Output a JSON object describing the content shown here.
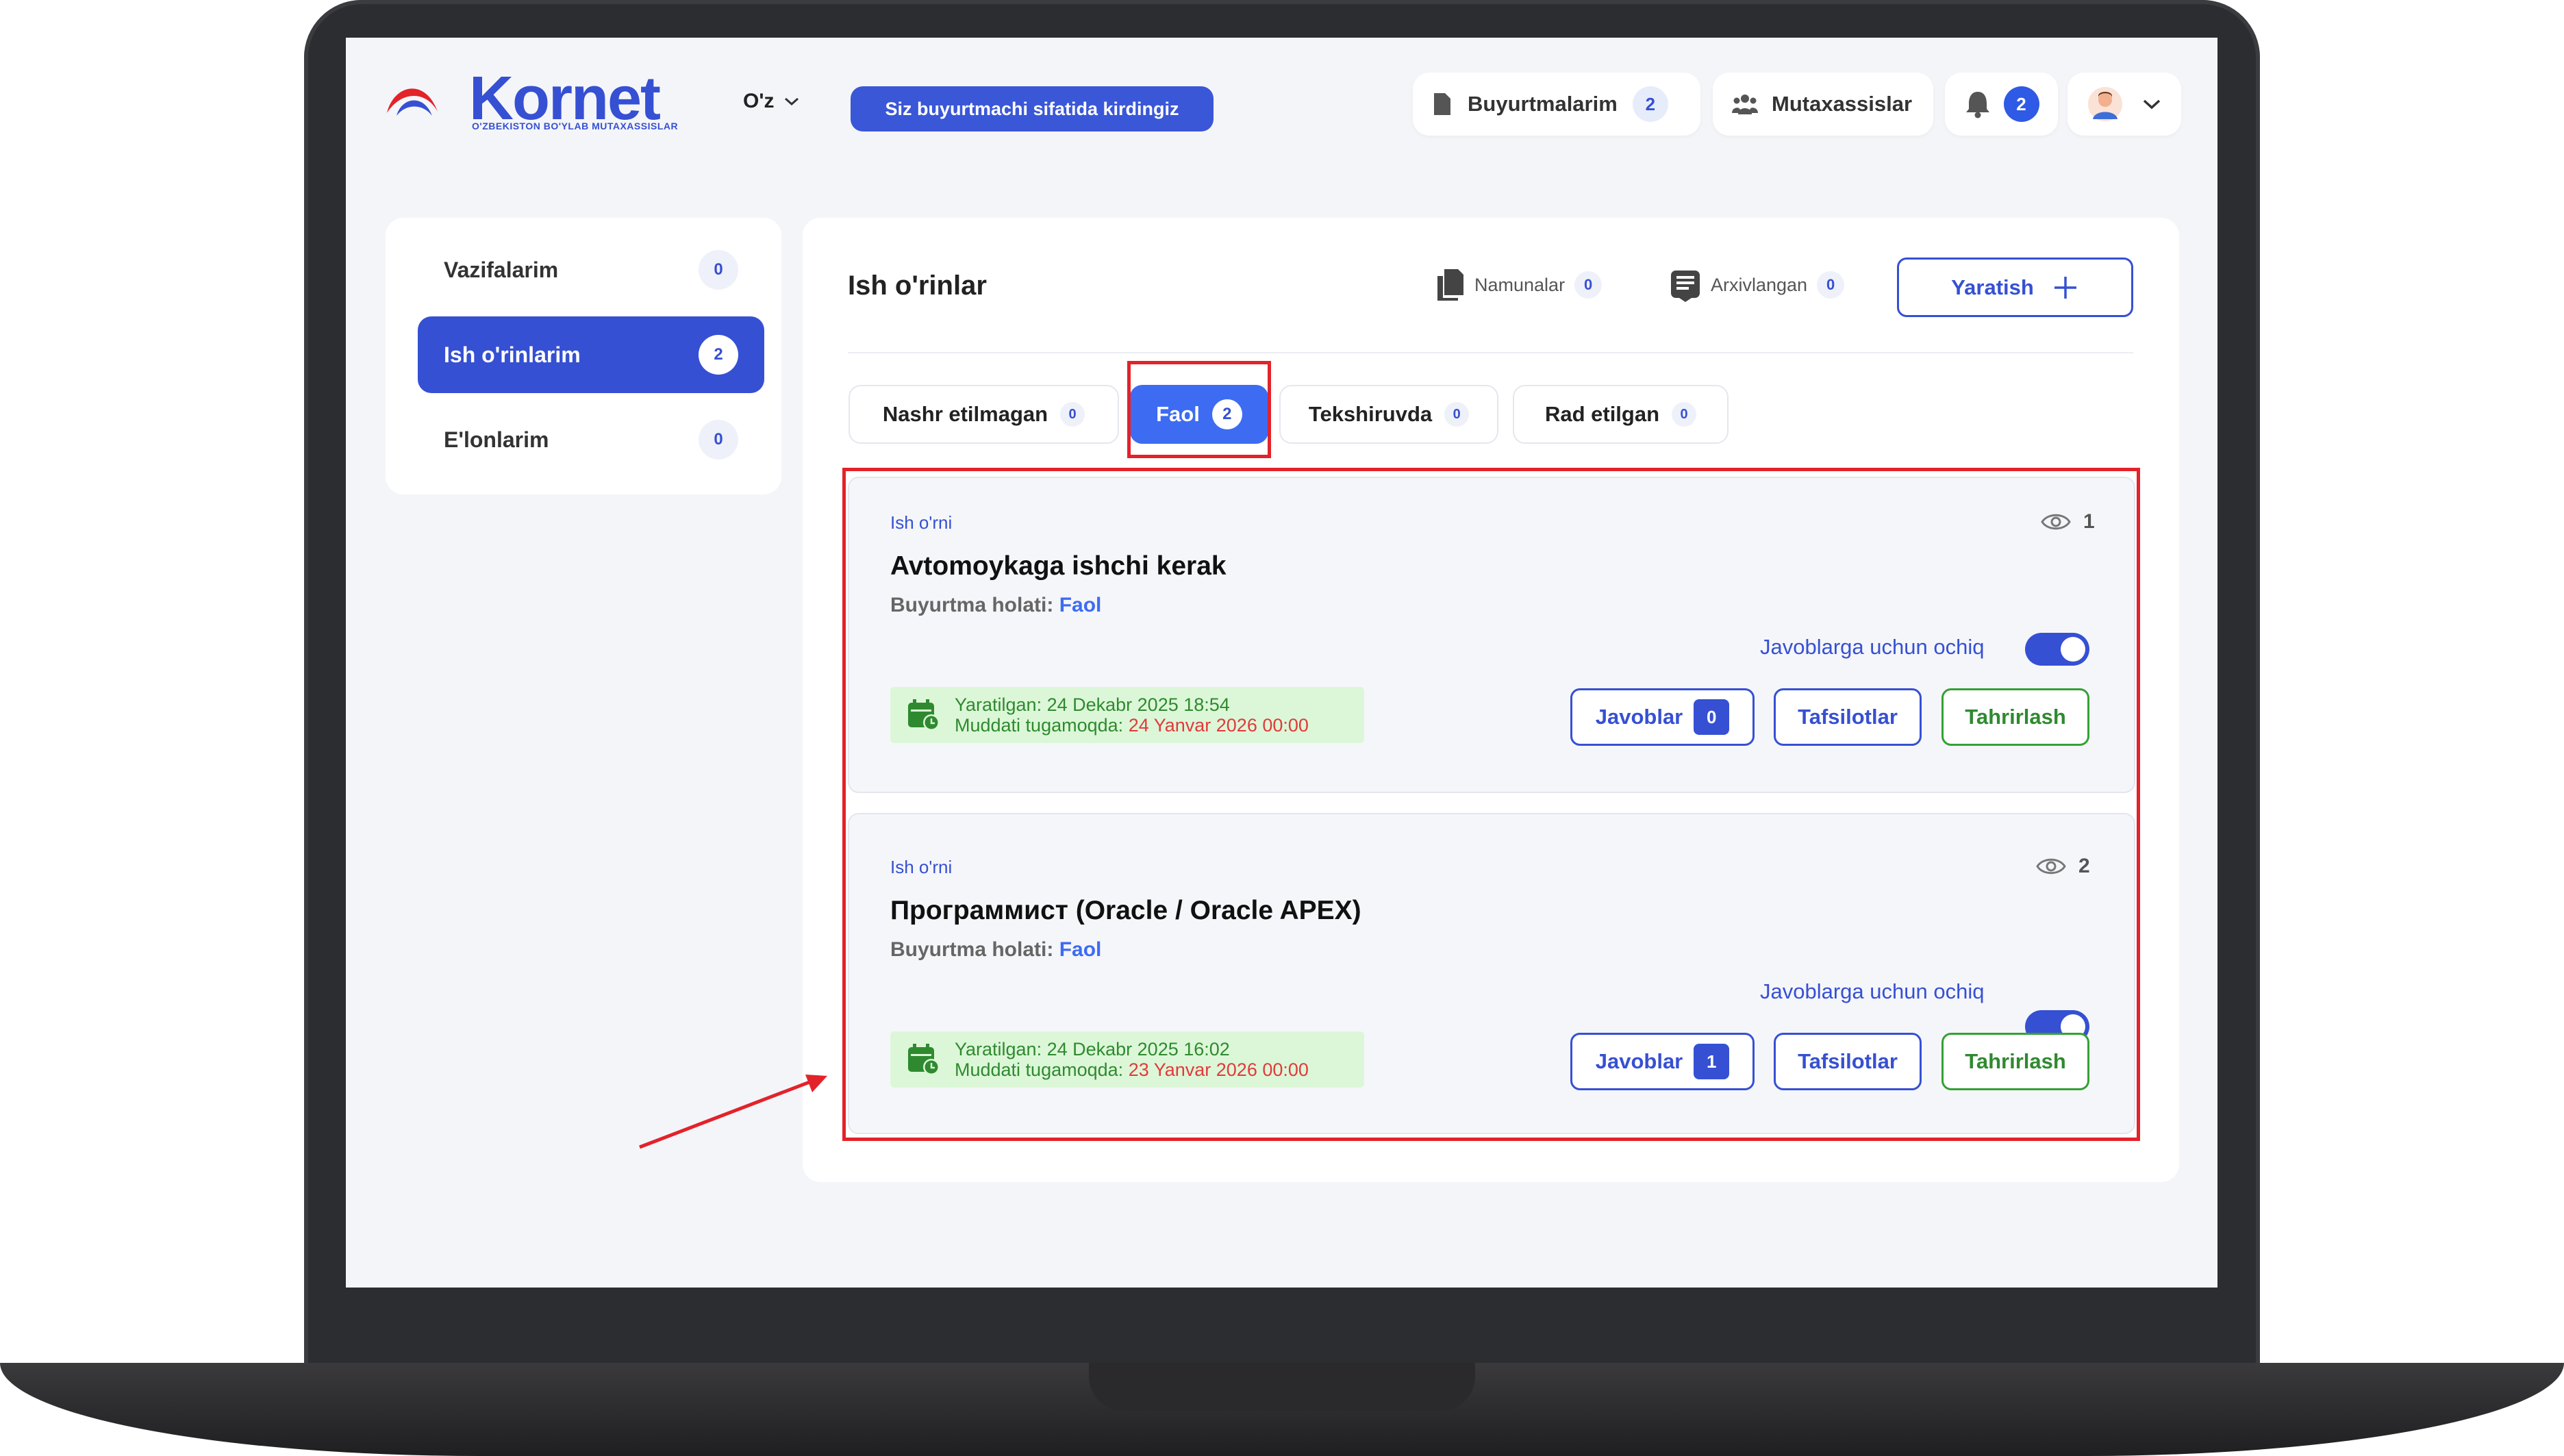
{
  "header": {
    "logo": "Kornet",
    "logo_subtitle": "O'ZBEKISTON BO'YLAB MUTAXASSISLAR",
    "language": "O'z",
    "role_badge": "Siz buyurtmachi sifatida kirdingiz",
    "orders_label": "Buyurtmalarim",
    "orders_count": "2",
    "specialists_label": "Mutaxassislar",
    "notifications_count": "2"
  },
  "sidebar": {
    "items": [
      {
        "label": "Vazifalarim",
        "count": "0"
      },
      {
        "label": "Ish o'rinlarim",
        "count": "2"
      },
      {
        "label": "E'lonlarim",
        "count": "0"
      }
    ]
  },
  "main": {
    "title": "Ish o'rinlar",
    "samples_label": "Namunalar",
    "samples_count": "0",
    "archived_label": "Arxivlangan",
    "archived_count": "0",
    "create_label": "Yaratish",
    "tabs": [
      {
        "label": "Nashr etilmagan",
        "count": "0"
      },
      {
        "label": "Faol",
        "count": "2"
      },
      {
        "label": "Tekshiruvda",
        "count": "0"
      },
      {
        "label": "Rad etilgan",
        "count": "0"
      }
    ],
    "jobs": [
      {
        "type": "Ish o'rni",
        "title": "Avtomoykaga ishchi kerak",
        "status_label": "Buyurtma holati:",
        "status_value": "Faol",
        "views": "1",
        "toggle_label": "Javoblarga uchun ochiq",
        "toggle_on": true,
        "created_label": "Yaratilgan:",
        "created_value": "24 Dekabr 2025 18:54",
        "deadline_label": "Muddati tugamoqda:",
        "deadline_value": "24 Yanvar 2026 00:00",
        "replies_label": "Javoblar",
        "replies_count": "0",
        "details_label": "Tafsilotlar",
        "edit_label": "Tahrirlash"
      },
      {
        "type": "Ish o'rni",
        "title": "Программист (Oracle / Oracle APEX)",
        "status_label": "Buyurtma holati:",
        "status_value": "Faol",
        "views": "2",
        "toggle_label": "Javoblarga uchun ochiq",
        "toggle_on": true,
        "created_label": "Yaratilgan:",
        "created_value": "24 Dekabr 2025 16:02",
        "deadline_label": "Muddati tugamoqda:",
        "deadline_value": "23 Yanvar 2026 00:00",
        "replies_label": "Javoblar",
        "replies_count": "1",
        "details_label": "Tafsilotlar",
        "edit_label": "Tahrirlash"
      }
    ]
  },
  "colors": {
    "brand": "#3650d3",
    "active_tab": "#3d6cf2",
    "annotation": "#e3222a",
    "date_bg": "#dcf7d8"
  }
}
